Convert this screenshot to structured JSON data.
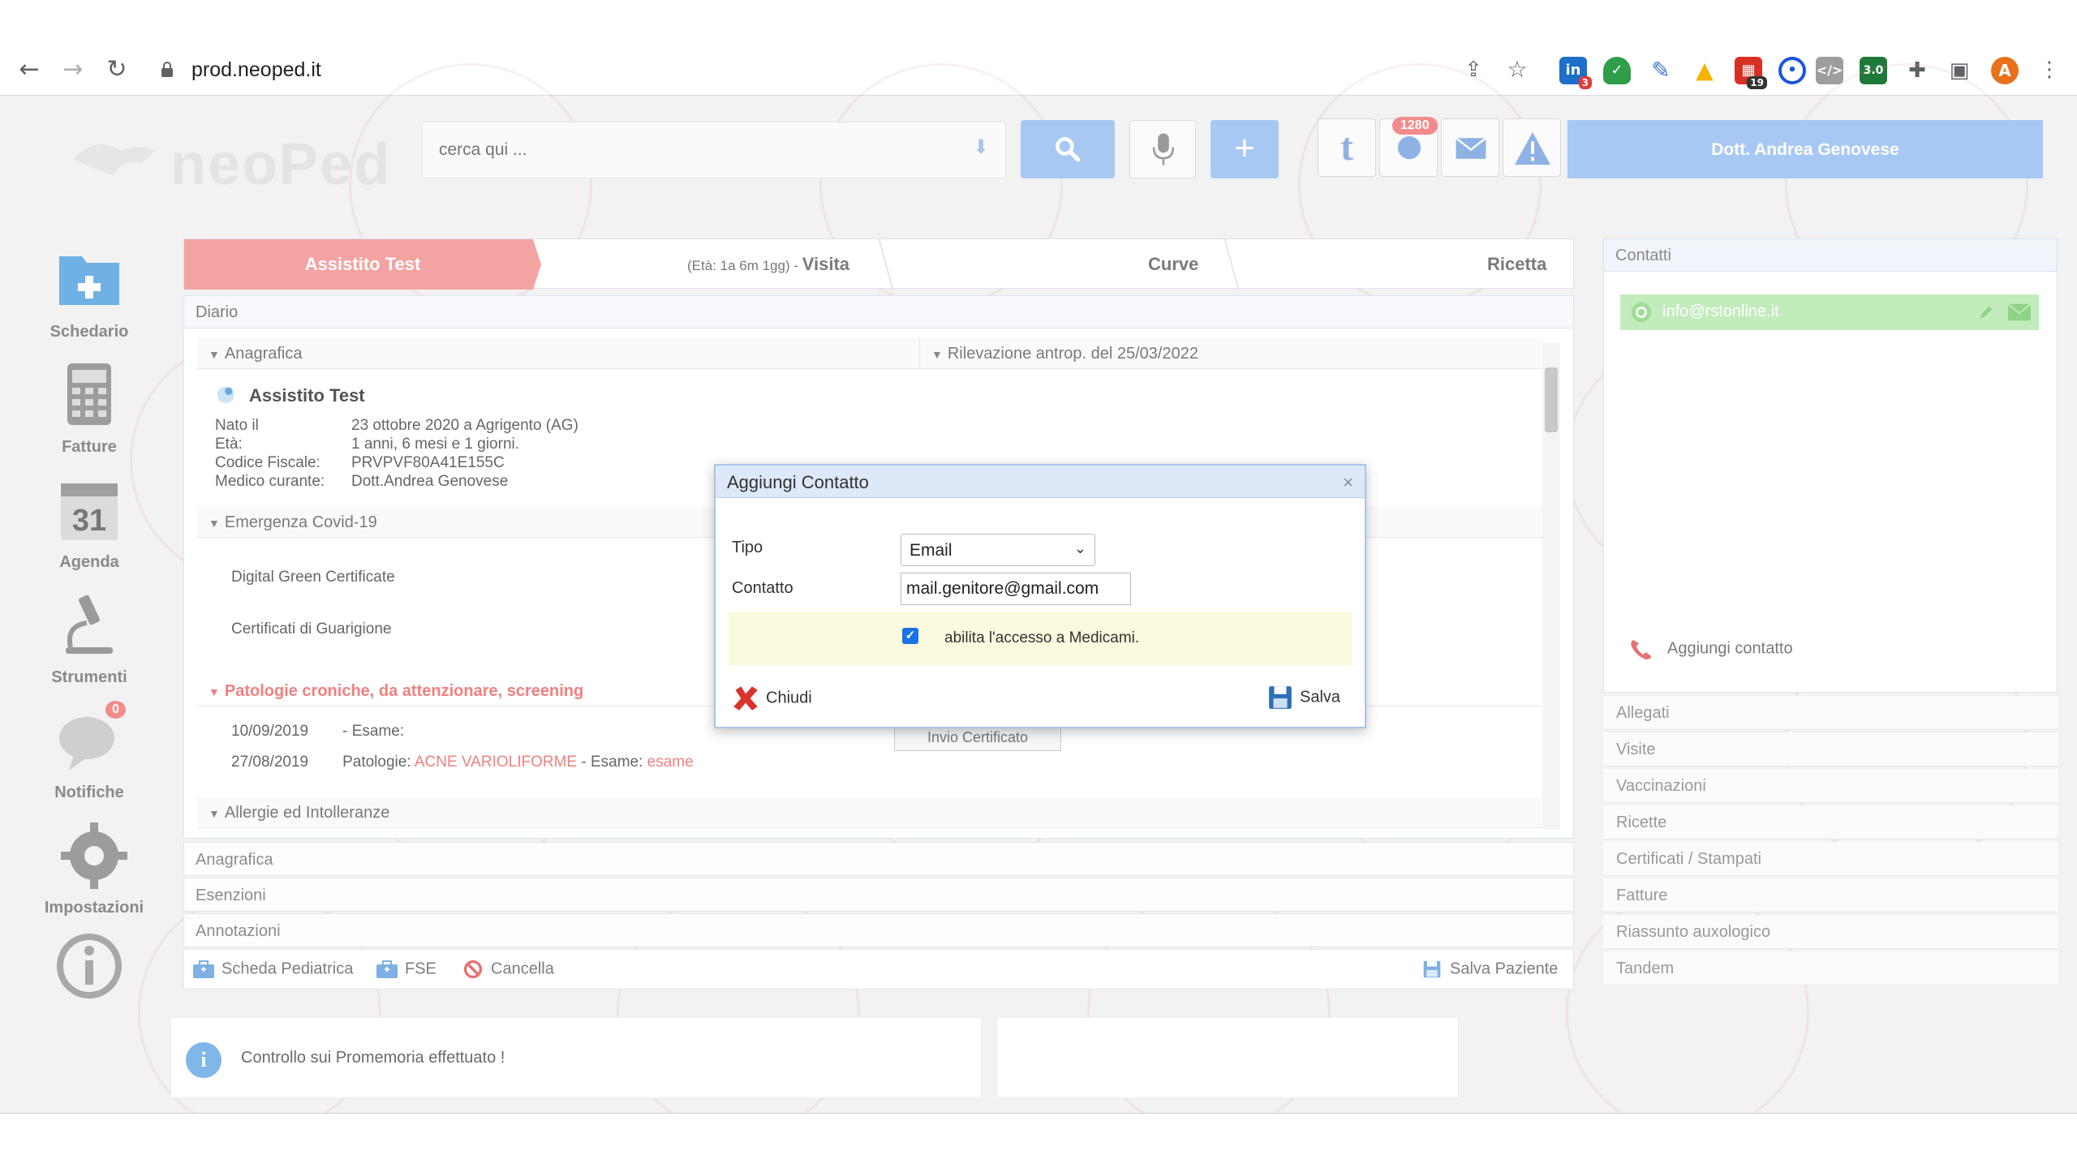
{
  "browser": {
    "url": "prod.neoped.it",
    "profile_initial": "A",
    "ext_badge_1": "3",
    "ext_badge_2": "19"
  },
  "header": {
    "logo_text": "neoPed",
    "search_placeholder": "cerca qui ...",
    "badge_count": "1280",
    "user_name": "Dott. Andrea Genovese",
    "tool_t": "t"
  },
  "sidebar": {
    "items": [
      {
        "label": "Schedario"
      },
      {
        "label": "Fatture"
      },
      {
        "label": "Agenda",
        "date": "31"
      },
      {
        "label": "Strumenti"
      },
      {
        "label": "Notifiche",
        "badge": "0"
      },
      {
        "label": "Impostazioni"
      }
    ]
  },
  "tabs": {
    "patient": "Assistito Test",
    "age_prefix": "(Età: 1a 6m 1gg) - ",
    "visita": "Visita",
    "curve": "Curve",
    "ricetta": "Ricetta"
  },
  "diario": {
    "title": "Diario",
    "anagrafica_head": "Anagrafica",
    "rilevazione_head": "Rilevazione antrop. del 25/03/2022",
    "patient_name": "Assistito Test",
    "labels": [
      "Nato il",
      "Età:",
      "Codice Fiscale:",
      "Medico curante:"
    ],
    "values": [
      "23 ottobre 2020 a Agrigento (AG)",
      "1 anni, 6 mesi e 1 giorni.",
      "PRVPVF80A41E155C",
      "Dott.Andrea Genovese"
    ],
    "covid_head": "Emergenza Covid-19",
    "covid_items": [
      "Digital Green Certificate",
      "Certificati di Guarigione"
    ],
    "invio_btn": "Invio Certificato",
    "patologie_head": "Patologie croniche, da attenzionare, screening",
    "patologie_rows": [
      {
        "date": "10/09/2019",
        "text": "- Esame:",
        "red1": "",
        "mid": "",
        "red2": ""
      },
      {
        "date": "27/08/2019",
        "text": "Patologie: ",
        "red1": "ACNE VARIOLIFORME",
        "mid": " - Esame: ",
        "red2": "esame"
      }
    ],
    "allergie_head": "Allergie ed Intolleranze"
  },
  "collapsed": [
    "Anagrafica",
    "Esenzioni",
    "Annotazioni"
  ],
  "actions": {
    "scheda": "Scheda Pediatrica",
    "fse": "FSE",
    "cancella": "Cancella",
    "salva_paziente": "Salva Paziente"
  },
  "contatti": {
    "title": "Contatti",
    "email": "info@rstonline.it",
    "add": "Aggiungi contatto"
  },
  "right_rows": [
    "Allegati",
    "Visite",
    "Vaccinazioni",
    "Ricette",
    "Certificati / Stampati",
    "Fatture",
    "Riassunto auxologico",
    "Tandem"
  ],
  "info": {
    "text": "Controllo sui Promemoria effettuato !"
  },
  "dialog": {
    "title": "Aggiungi Contatto",
    "close": "×",
    "tipo_label": "Tipo",
    "tipo_value": "Email",
    "contatto_label": "Contatto",
    "contatto_value": "mail.genitore@gmail.com",
    "checkbox_label": "abilita l'accesso a Medicami.",
    "chiudi": "Chiudi",
    "salva": "Salva"
  }
}
